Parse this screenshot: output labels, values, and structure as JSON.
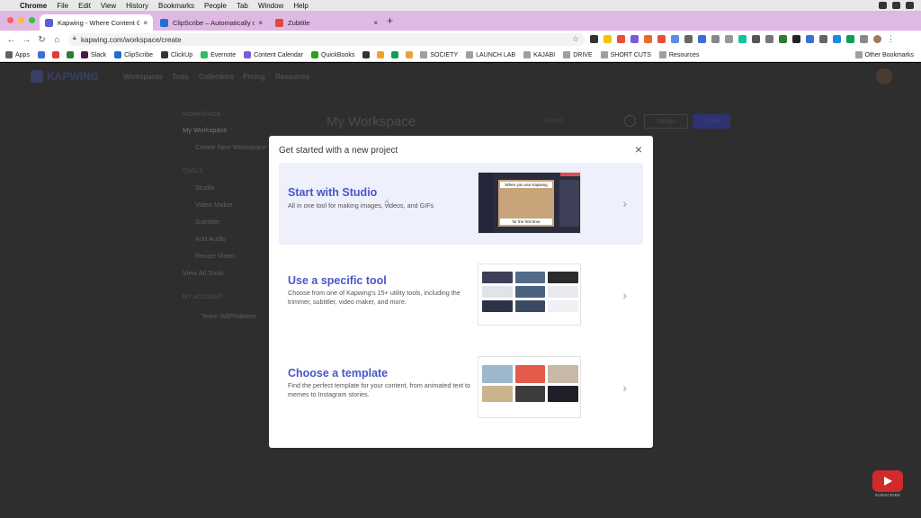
{
  "menubar": {
    "items": [
      "Chrome",
      "File",
      "Edit",
      "View",
      "History",
      "Bookmarks",
      "People",
      "Tab",
      "Window",
      "Help"
    ]
  },
  "tabs": [
    {
      "label": "Kapwing - Where Content Crea",
      "color": "#5a5fd6",
      "active": true
    },
    {
      "label": "ClipScribe – Automatically cre",
      "color": "#1f6fd6",
      "active": false
    },
    {
      "label": "Zubtitle",
      "color": "#e0483e",
      "active": false
    }
  ],
  "address": {
    "url": "kapwing.com/workspace/create"
  },
  "bookmarks": [
    {
      "label": "Apps",
      "color": "#5f6368"
    },
    {
      "label": "",
      "color": "#3b6fd6"
    },
    {
      "label": "",
      "color": "#e53935"
    },
    {
      "label": "",
      "color": "#2e7d32"
    },
    {
      "label": "Slack",
      "color": "#4a154b"
    },
    {
      "label": "ClipScribe",
      "color": "#1f6fd6"
    },
    {
      "label": "ClickUp",
      "color": "#333333"
    },
    {
      "label": "Evernote",
      "color": "#2dbe60"
    },
    {
      "label": "Content Calendar",
      "color": "#7b5cd6"
    },
    {
      "label": "QuickBooks",
      "color": "#2ca01c"
    },
    {
      "label": "",
      "color": "#333333"
    },
    {
      "label": "",
      "color": "#f4a025"
    },
    {
      "label": "",
      "color": "#0f9d58"
    },
    {
      "label": "",
      "color": "#e8a33d"
    },
    {
      "label": "SOCIETY",
      "color": "folder"
    },
    {
      "label": "LAUNCH LAB",
      "color": "folder"
    },
    {
      "label": "KAJABI",
      "color": "folder"
    },
    {
      "label": "DRIVE",
      "color": "folder"
    },
    {
      "label": "SHORT CUTS",
      "color": "folder"
    },
    {
      "label": "Resources",
      "color": "folder"
    }
  ],
  "other_bookmarks": "Other Bookmarks",
  "background": {
    "logo": "KAPWING",
    "nav": [
      "Workspaces",
      "Tools",
      "Collections",
      "Pricing",
      "Resources"
    ],
    "workspace_header": "WORKSPACE",
    "my_workspace": "My Workspace",
    "create_new": "Create New Workspace",
    "tools_header": "TOOLS",
    "tools": [
      "Studio",
      "Video Maker",
      "Subtitler",
      "Add Audio",
      "Resize Video",
      "View All Tools"
    ],
    "account_header": "MY ACCOUNT",
    "account_name": "Team WilPhaktem",
    "page_title": "My Workspace",
    "search_placeholder": "Search",
    "upload_label": "Upload",
    "share_label": "Share"
  },
  "modal": {
    "title": "Get started with a new project",
    "close": "×",
    "options": [
      {
        "title": "Start with Studio",
        "desc": "All in one tool for making images, videos, and GIFs",
        "thumb_caption_top": "When you use Kapwing",
        "thumb_caption_bottom": "for the first time"
      },
      {
        "title": "Use a specific tool",
        "desc": "Choose from one of Kapwing's 15+ utility tools, including the trimmer, subtitler, video maker, and more."
      },
      {
        "title": "Choose a template",
        "desc": "Find the perfect template for your content, from animated text to memes to Instagram stories."
      }
    ]
  },
  "watermark": {
    "label": "SUBSCRIBE"
  }
}
